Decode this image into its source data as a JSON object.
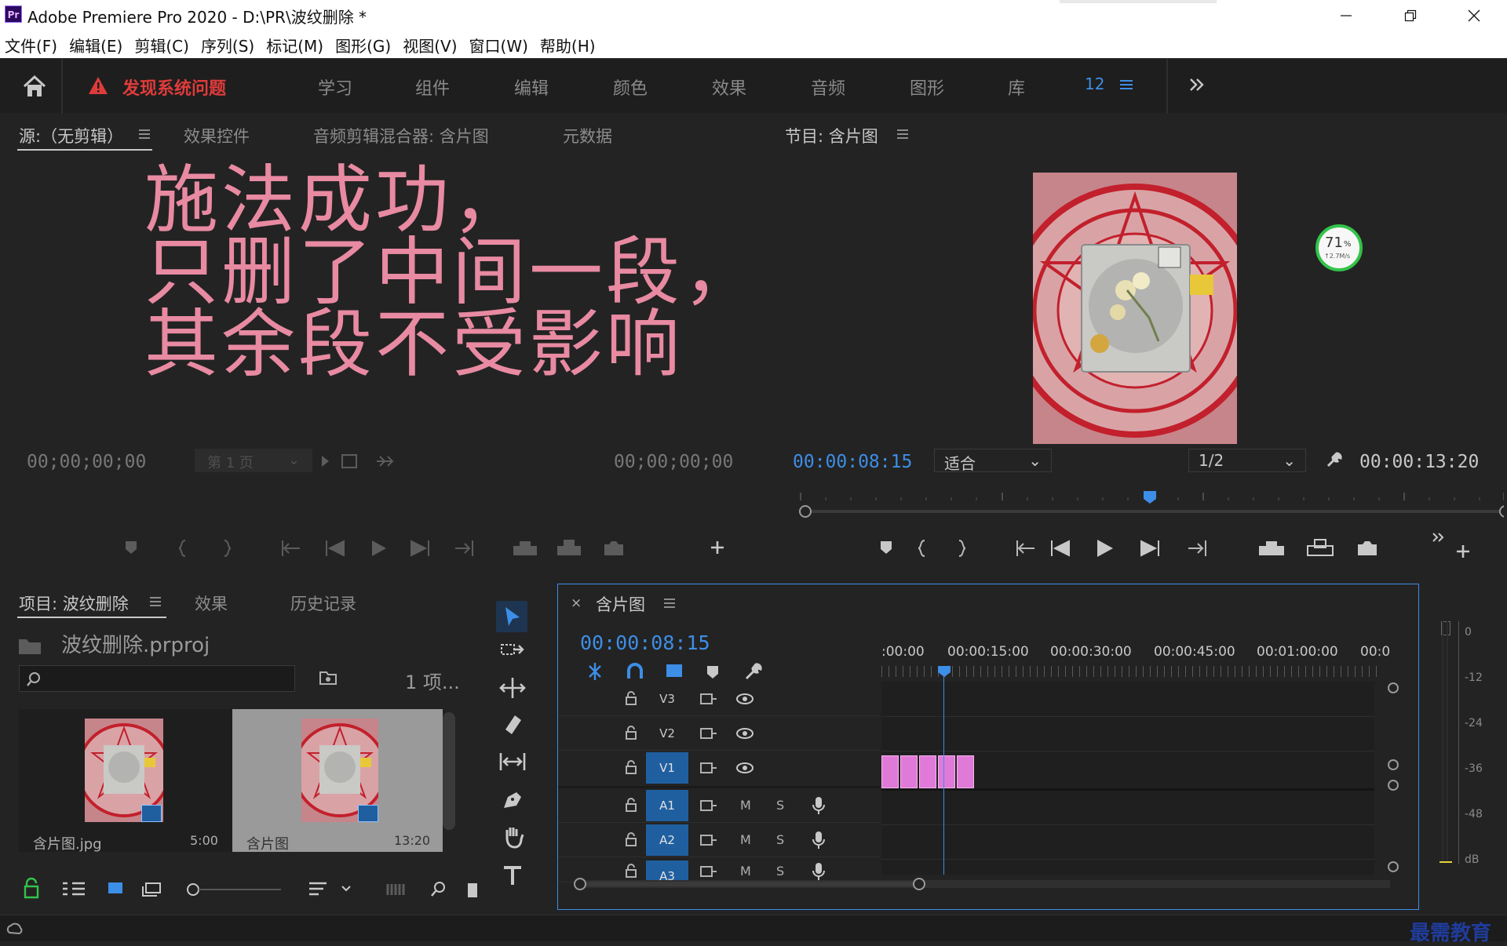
{
  "window": {
    "app_icon": "Pr",
    "title": "Adobe Premiere Pro 2020 - D:\\PR\\波纹删除 *",
    "controls": [
      "minimize-icon",
      "restore-icon",
      "close-icon"
    ]
  },
  "menu": [
    "文件(F)",
    "编辑(E)",
    "剪辑(C)",
    "序列(S)",
    "标记(M)",
    "图形(G)",
    "视图(V)",
    "窗口(W)",
    "帮助(H)"
  ],
  "workspace": {
    "warning": "发现系统问题",
    "tabs": [
      "学习",
      "组件",
      "编辑",
      "颜色",
      "效果",
      "音频",
      "图形",
      "库"
    ],
    "count": "12"
  },
  "source_panel": {
    "tabs": [
      "源:（无剪辑）",
      "效果控件",
      "音频剪辑混合器: 含片图",
      "元数据"
    ],
    "overlay_text": [
      "施法成功，",
      "只删了中间一段，",
      "其余段不受影响"
    ],
    "timecode_in": "00;00;00;00",
    "timecode_out": "00;00;00;00",
    "page_select": "第 1 页"
  },
  "program_panel": {
    "tab": "节目: 含片图",
    "timecode": "00:00:08:15",
    "fit": "适合",
    "resolution": "1/2",
    "duration": "00:00:13:20",
    "net_badge_percent": "71",
    "net_badge_unit": "%",
    "net_badge_rate": "↑2.7M/s"
  },
  "project_panel": {
    "tabs": [
      "项目: 波纹删除",
      "效果",
      "历史记录"
    ],
    "project_file": "波纹删除.prproj",
    "item_count": "1 项...",
    "items": [
      {
        "name": "含片图.jpg",
        "duration": "5:00"
      },
      {
        "name": "含片图",
        "duration": "13:20"
      }
    ]
  },
  "timeline": {
    "tab": "含片图",
    "timecode": "00:00:08:15",
    "ruler": [
      ":00:00",
      "00:00:15:00",
      "00:00:30:00",
      "00:00:45:00",
      "00:01:00:00",
      "00:0"
    ],
    "video_tracks": [
      "V3",
      "V2",
      "V1"
    ],
    "audio_tracks": [
      "A1",
      "A2",
      "A3"
    ],
    "mute": "M",
    "solo": "S"
  },
  "meter": {
    "labels": [
      "0",
      "-12",
      "-24",
      "-36",
      "-48",
      "dB"
    ]
  },
  "watermark": "最需教育",
  "colors": {
    "accent": "#3d8ee6",
    "warning": "#e03b3b",
    "overlay_text": "#e88aa2",
    "clip": "#e07ad8",
    "active_track": "#1f5fa0"
  }
}
